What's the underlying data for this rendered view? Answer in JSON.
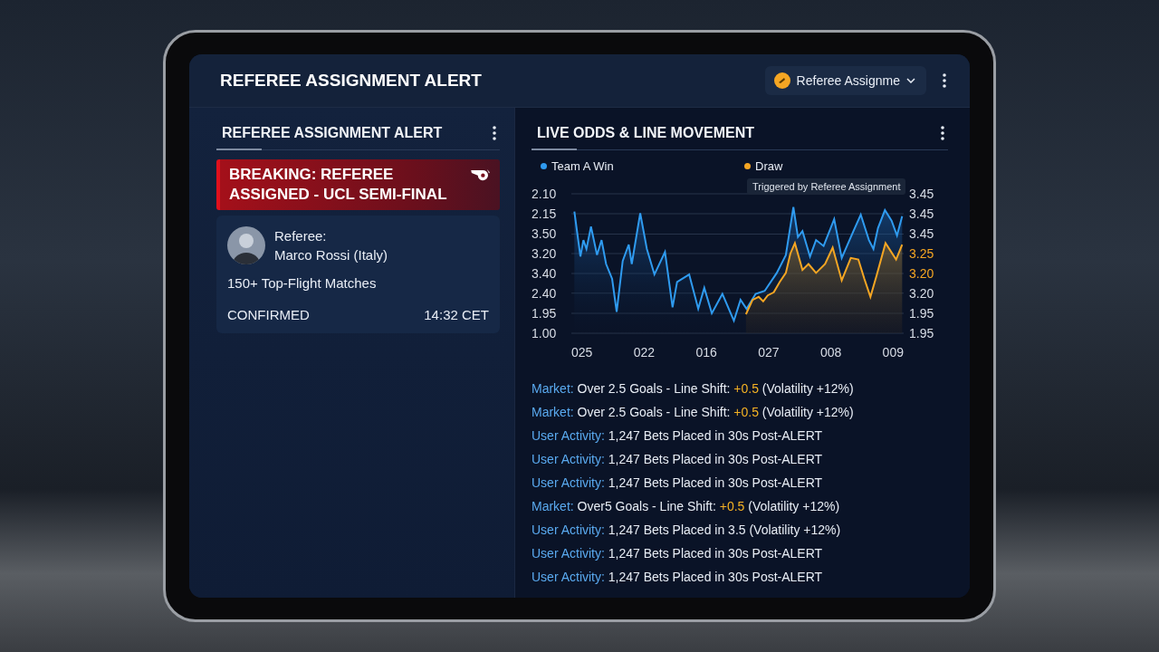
{
  "header": {
    "title": "REFEREE ASSIGNMENT ALERT",
    "dropdown": {
      "label": "Referee Assignme"
    }
  },
  "left_panel": {
    "title": "REFEREE ASSIGNMENT ALERT",
    "alert": {
      "headline": "BREAKING: REFEREE ASSIGNED - UCL SEMI-FINAL"
    },
    "referee_card": {
      "label": "Referee:",
      "name": "Marco Rossi (Italy)",
      "experience": "150+ Top-Flight Matches",
      "status": "CONFIRMED",
      "time": "14:32 CET"
    }
  },
  "right_panel": {
    "title": "LIVE ODDS & LINE MOVEMENT",
    "legend": [
      {
        "name": "Team A Win",
        "color": "#2f9bf0"
      },
      {
        "name": "Draw",
        "color": "#f5a623"
      }
    ],
    "tooltip": "Triggered by Referee Assignment",
    "left_axis_labels": [
      "2.10",
      "2.15",
      "3.50",
      "3.20",
      "3.40",
      "2.40",
      "1.95",
      "1.00"
    ],
    "right_axis_labels": [
      {
        "text": "3.45",
        "color": "#d8dde6"
      },
      {
        "text": "3.45",
        "color": "#d8dde6"
      },
      {
        "text": "3.45",
        "color": "#d8dde6"
      },
      {
        "text": "3.25",
        "color": "#f5a623"
      },
      {
        "text": "3.20",
        "color": "#f5a623"
      },
      {
        "text": "3.20",
        "color": "#d8dde6"
      },
      {
        "text": "1.95",
        "color": "#d8dde6"
      },
      {
        "text": "1.95",
        "color": "#d8dde6"
      }
    ],
    "x_labels": [
      "025",
      "022",
      "016",
      "027",
      "008",
      "009"
    ],
    "feed": [
      {
        "label": "Market:",
        "parts": [
          {
            "kind": "plain",
            "text": "Over 2.5 Goals - Line Shift:"
          },
          {
            "kind": "highlight",
            "text": "+0.5"
          },
          {
            "kind": "plain",
            "text": "(Volatility +12%)"
          }
        ]
      },
      {
        "label": "Market:",
        "parts": [
          {
            "kind": "plain",
            "text": "Over 2.5 Goals - Line Shift:"
          },
          {
            "kind": "highlight",
            "text": "+0.5"
          },
          {
            "kind": "plain",
            "text": "(Volatility +12%)"
          }
        ]
      },
      {
        "label": "User Activity:",
        "parts": [
          {
            "kind": "plain",
            "text": "1,247 Bets Placed in 30s Post-ALERT"
          }
        ]
      },
      {
        "label": "User Activity:",
        "parts": [
          {
            "kind": "plain",
            "text": "1,247 Bets Placed in 30s Post-ALERT"
          }
        ]
      },
      {
        "label": "User Activity:",
        "parts": [
          {
            "kind": "plain",
            "text": "1,247 Bets Placed in 30s Post-ALERT"
          }
        ]
      },
      {
        "label": "Market:",
        "parts": [
          {
            "kind": "plain",
            "text": "Over5 Goals - Line Shift:"
          },
          {
            "kind": "highlight",
            "text": "+0.5"
          },
          {
            "kind": "plain",
            "text": "(Volatility +12%)"
          }
        ]
      },
      {
        "label": "User Activity:",
        "parts": [
          {
            "kind": "plain",
            "text": "1,247 Bets Placed in 3.5 (Volatility +12%)"
          }
        ]
      },
      {
        "label": "User Activity:",
        "parts": [
          {
            "kind": "plain",
            "text": "1,247 Bets Placed in 30s Post-ALERT"
          }
        ]
      },
      {
        "label": "User Activity:",
        "parts": [
          {
            "kind": "plain",
            "text": "1,247 Bets Placed in 30s Post-ALERT"
          }
        ]
      }
    ]
  }
}
